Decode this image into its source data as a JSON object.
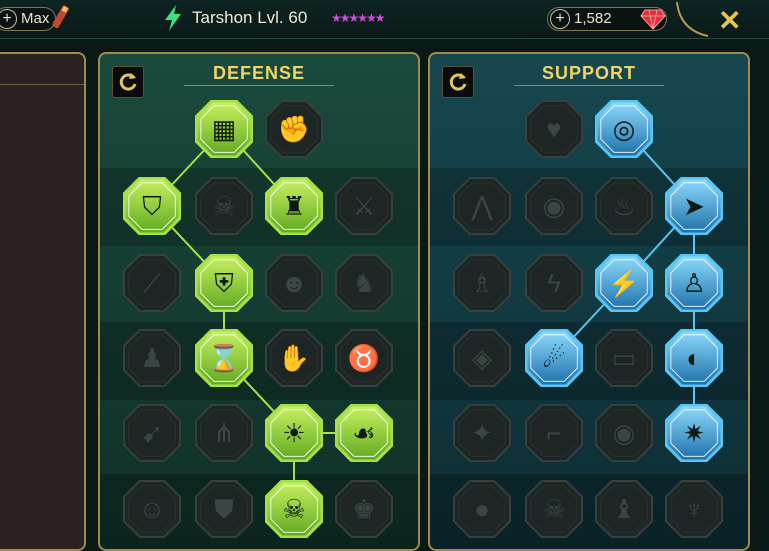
{
  "topbar": {
    "max_label": "Max",
    "champion_title": "Tarshon Lvl. 60",
    "stars": "★★★★★★",
    "gems_value": "1,582",
    "close_label": "✕"
  },
  "colors": {
    "defense_active": "#a5e24a",
    "support_active": "#58c5f5",
    "gold": "#e5c558"
  },
  "panels": {
    "defense": {
      "title": "DEFENSE",
      "nodes": [
        {
          "icon": "bricks-wall-icon",
          "active": true
        },
        {
          "icon": "fist-icon",
          "active": false
        },
        {
          "icon": "shield-chevron-icon",
          "active": true
        },
        {
          "icon": "skull-torch-icon",
          "active": false
        },
        {
          "icon": "muscle-warrior-icon",
          "active": true
        },
        {
          "icon": "crossed-swords-icon",
          "active": false
        },
        {
          "icon": "dagger-slash-icon",
          "active": false
        },
        {
          "icon": "knight-shield-icon",
          "active": true
        },
        {
          "icon": "face-icon",
          "active": false
        },
        {
          "icon": "helmet-bust-icon",
          "active": false
        },
        {
          "icon": "armored-figure-icon",
          "active": false
        },
        {
          "icon": "hourglass-burst-icon",
          "active": true
        },
        {
          "icon": "open-hand-icon",
          "active": false
        },
        {
          "icon": "horned-skull-icon",
          "active": false
        },
        {
          "icon": "runner-icon",
          "active": false
        },
        {
          "icon": "claw-icon",
          "active": false
        },
        {
          "icon": "radiant-skull-icon",
          "active": true
        },
        {
          "icon": "healing-hand-icon",
          "active": true
        },
        {
          "icon": "mask-icon",
          "active": false
        },
        {
          "icon": "shield-face-icon",
          "active": false
        },
        {
          "icon": "ghost-skull-icon",
          "active": true
        },
        {
          "icon": "warrior-icon",
          "active": false
        }
      ]
    },
    "support": {
      "title": "SUPPORT",
      "nodes": [
        {
          "icon": "heart-sparkle-icon",
          "active": false
        },
        {
          "icon": "shattered-target-icon",
          "active": true
        },
        {
          "icon": "praying-hands-icon",
          "active": false
        },
        {
          "icon": "concentric-shield-icon",
          "active": false
        },
        {
          "icon": "skull-fire-icon",
          "active": false
        },
        {
          "icon": "dash-arrow-icon",
          "active": true
        },
        {
          "icon": "statue-icon",
          "active": false
        },
        {
          "icon": "lightning-shield-icon",
          "active": false
        },
        {
          "icon": "crack-blast-icon",
          "active": true
        },
        {
          "icon": "twin-figures-icon",
          "active": true
        },
        {
          "icon": "gem-chest-icon",
          "active": false
        },
        {
          "icon": "meteor-icon",
          "active": true
        },
        {
          "icon": "open-book-icon",
          "active": false
        },
        {
          "icon": "angry-eyes-icon",
          "active": true
        },
        {
          "icon": "compass-star-icon",
          "active": false
        },
        {
          "icon": "boot-icon",
          "active": false
        },
        {
          "icon": "eye-icon",
          "active": false
        },
        {
          "icon": "spark-figure-icon",
          "active": true
        },
        {
          "icon": "bomb-icon",
          "active": false
        },
        {
          "icon": "skull-icon",
          "active": false
        },
        {
          "icon": "robed-figure-icon",
          "active": false
        },
        {
          "icon": "eagle-icon",
          "active": false
        }
      ]
    }
  }
}
